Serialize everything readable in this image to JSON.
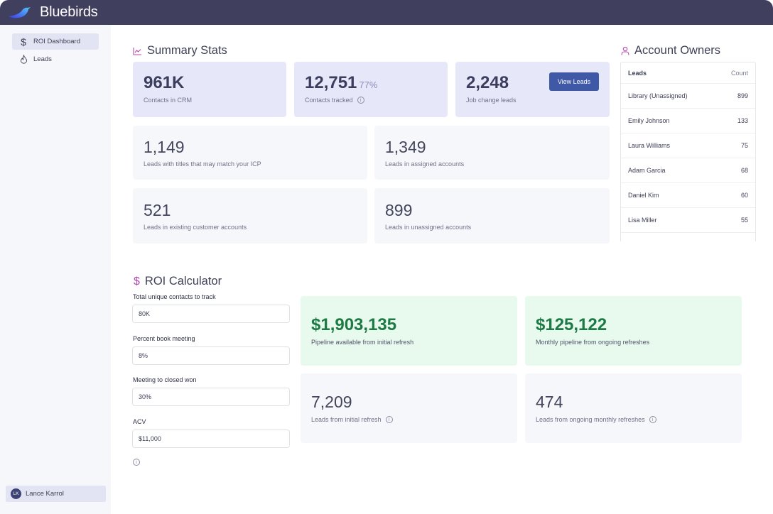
{
  "app": {
    "brand": "Bluebirds"
  },
  "sidebar": {
    "items": [
      {
        "label": "ROI Dashboard",
        "icon": "dollar-icon",
        "active": true
      },
      {
        "label": "Leads",
        "icon": "flame-icon",
        "active": false
      }
    ],
    "user": {
      "initials": "LK",
      "name": "Lance Karrol"
    }
  },
  "summary": {
    "title": "Summary Stats",
    "top_cards": [
      {
        "value": "961K",
        "label": "Contacts in CRM"
      },
      {
        "value": "12,751",
        "percent": "77%",
        "label": "Contacts tracked"
      },
      {
        "value": "2,248",
        "label": "Job change leads",
        "button": "View Leads"
      }
    ],
    "grid_cards": [
      {
        "value": "1,149",
        "label": "Leads with titles that may match your ICP"
      },
      {
        "value": "1,349",
        "label": "Leads in assigned accounts"
      },
      {
        "value": "521",
        "label": "Leads in existing customer accounts"
      },
      {
        "value": "899",
        "label": "Leads in unassigned accounts"
      }
    ]
  },
  "owners": {
    "title": "Account Owners",
    "headers": {
      "name": "Leads",
      "count": "Count"
    },
    "rows": [
      {
        "name": "Library (Unassigned)",
        "count": "899"
      },
      {
        "name": "Emily Johnson",
        "count": "133"
      },
      {
        "name": "Laura Williams",
        "count": "75"
      },
      {
        "name": "Adam Garcia",
        "count": "68"
      },
      {
        "name": "Daniel Kim",
        "count": "60"
      },
      {
        "name": "Lisa Miller",
        "count": "55"
      }
    ]
  },
  "roi": {
    "title": "ROI Calculator",
    "fields": [
      {
        "label": "Total unique contacts to track",
        "value": "80K"
      },
      {
        "label": "Percent book meeting",
        "value": "8%"
      },
      {
        "label": "Meeting to closed won",
        "value": "30%"
      },
      {
        "label": "ACV",
        "value": "$11,000"
      }
    ],
    "results": [
      {
        "value": "$1,903,135",
        "label": "Pipeline available from initial refresh"
      },
      {
        "value": "$125,122",
        "label": "Monthly pipeline from ongoing refreshes"
      },
      {
        "value": "7,209",
        "label": "Leads from initial refresh"
      },
      {
        "value": "474",
        "label": "Leads from ongoing monthly refreshes"
      }
    ]
  },
  "colors": {
    "topbar": "#413f5e",
    "accent": "#4059a6",
    "icon_accent": "#b54bb0",
    "positive": "#1d7a44"
  }
}
